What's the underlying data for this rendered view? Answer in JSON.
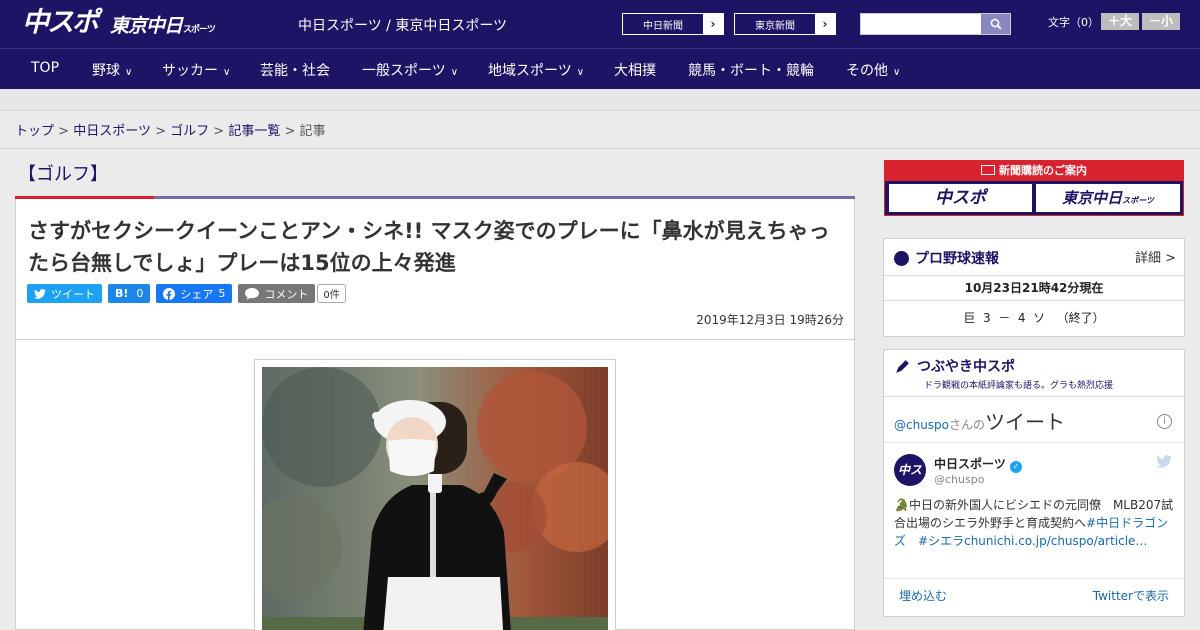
{
  "header": {
    "logo_chuspo": "中スポ",
    "logo_tokyo": "東京中日",
    "logo_tokyo_small": "スポーツ",
    "tagline": "中日スポーツ / 東京中日スポーツ",
    "link_chunichi": "中日新聞",
    "link_tokyo": "東京新聞",
    "search_icon": "search-icon",
    "font_label": "文字（0）",
    "font_plus": "＋大",
    "font_minus": "－小"
  },
  "nav": {
    "items": [
      "TOP",
      "野球",
      "サッカー",
      "芸能・社会",
      "一般スポーツ",
      "地域スポーツ",
      "大相撲",
      "競馬・ボート・競輪",
      "その他"
    ]
  },
  "breadcrumb": {
    "top": "トップ",
    "chuspo": "中日スポーツ",
    "golf": "ゴルフ",
    "list": "記事一覧",
    "current": "記事",
    "sep": ">"
  },
  "article": {
    "category": "【ゴルフ】",
    "title": "さすがセクシークイーンことアン・シネ!! マスク姿でのプレーに「鼻水が見えちゃったら台無しでしょ」プレーは15位の上々発進",
    "share": {
      "tweet": "ツイート",
      "hatena": "B!",
      "hatena_count": "0",
      "facebook": "シェア",
      "facebook_count": "5",
      "comment": "コメント",
      "comment_count": "0件"
    },
    "date": "2019年12月3日 19時26分"
  },
  "sidebar": {
    "subscribe": {
      "heading": "新聞購読のご案内",
      "btn1": "中スポ",
      "btn2": "東京中日",
      "btn2_small": "スポーツ"
    },
    "baseball": {
      "title": "プロ野球速報",
      "detail": "詳細 >",
      "updated": "10月23日21時42分現在",
      "score": "巨  3  －  4  ソ   （終了）"
    },
    "tsubuyaki": {
      "title": "つぶやき中スポ",
      "subtitle": "ドラ観戦の本紙評論家も語る。グラも熱烈応援",
      "header_handle": "@chuspo",
      "header_san": "さんの",
      "header_tweet": "ツイート",
      "account_name": "中日スポーツ",
      "account_handle": "@chuspo",
      "tweet_text": "🐊中日の新外国人にビシエドの元同僚　MLB207試合出場のシエラ外野手と育成契約へ",
      "tweet_tag1": "#中日ドラゴンズ",
      "tweet_tag2": "#シエラ",
      "tweet_link": "chunichi.co.jp/chuspo/article…",
      "embed": "埋め込む",
      "view_on": "Twitterで表示"
    }
  },
  "colors": {
    "brand_navy": "#1e1466",
    "accent_red": "#d8222d",
    "twitter_blue": "#1da1f2",
    "facebook_blue": "#1877f2"
  }
}
